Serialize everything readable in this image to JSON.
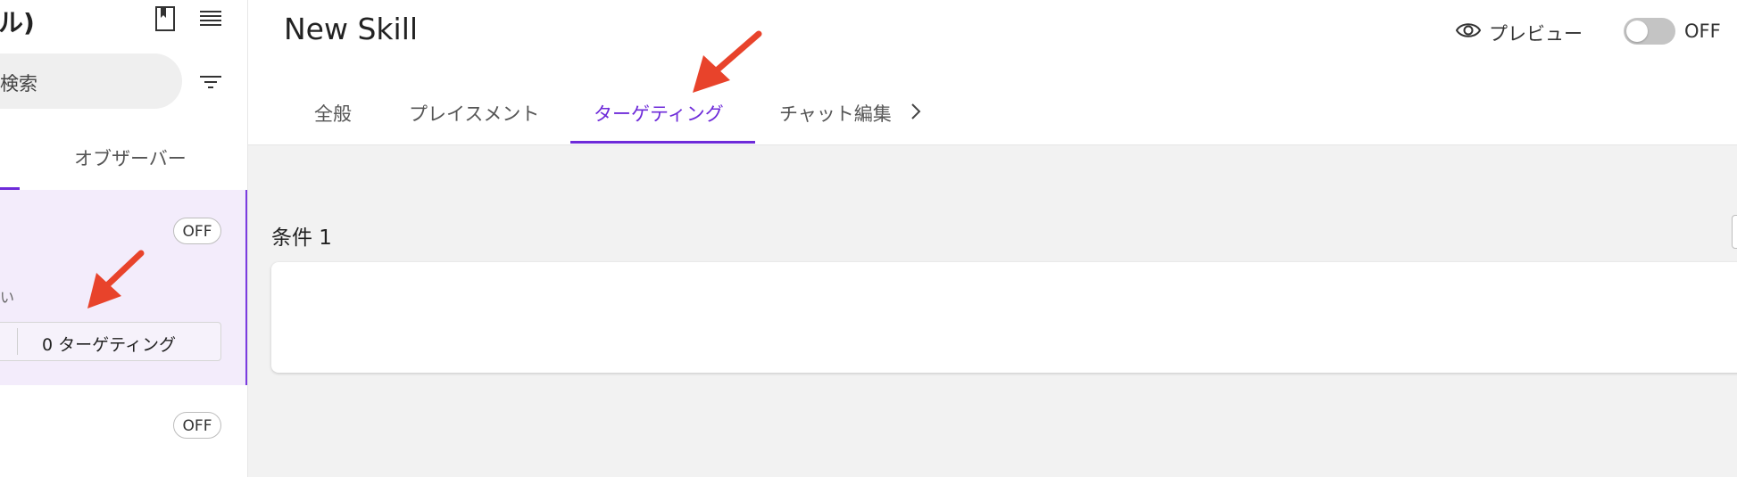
{
  "sidebar": {
    "title_fragment": "ル)",
    "icons": {
      "bookmark": "bookmark-icon",
      "menu": "list-icon",
      "filter": "filter-icon"
    },
    "search_placeholder_fragment": "検索",
    "tab_observer": "オブザーバー",
    "cards": [
      {
        "status": "OFF",
        "text_fragment": "い",
        "targeting_count_label": "0 ターゲティング"
      },
      {
        "status": "OFF"
      }
    ]
  },
  "header": {
    "title": "New Skill",
    "preview_label": "プレビュー",
    "toggle_label": "OFF",
    "tabs": [
      {
        "label": "全般"
      },
      {
        "label": "プレイスメント"
      },
      {
        "label": "ターゲティング",
        "active": true
      },
      {
        "label": "チャット編集"
      }
    ]
  },
  "body": {
    "condition_label": "条件 1"
  },
  "colors": {
    "accent": "#6e2bd9",
    "arrow": "#e8432b",
    "card_bg": "#f3ecfb"
  }
}
